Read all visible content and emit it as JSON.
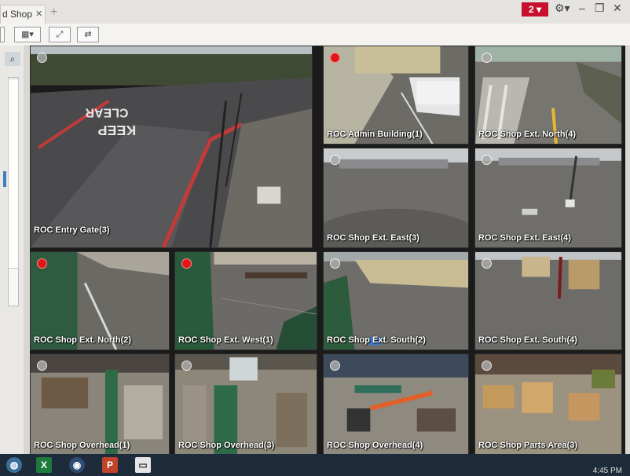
{
  "window": {
    "tab_title": "d Shop",
    "tab_close_icon": "close-icon",
    "alert_count": "2",
    "settings_icon": "gear-icon"
  },
  "toolbar": {
    "layout_button_icon": "grid-layout-icon",
    "fullscreen_icon": "expand-icon",
    "swap_icon": "swap-icon"
  },
  "cameras": [
    {
      "label": "ROC Entry Gate(3)",
      "recording": false
    },
    {
      "label": "ROC Admin Building(1)",
      "recording": true
    },
    {
      "label": "ROC Shop Ext. North(4)",
      "recording": false
    },
    {
      "label": "ROC Shop Ext. East(3)",
      "recording": false
    },
    {
      "label": "ROC Shop Ext. East(4)",
      "recording": false
    },
    {
      "label": "ROC Shop Ext. North(2)",
      "recording": true
    },
    {
      "label": "ROC Shop Ext. West(1)",
      "recording": true
    },
    {
      "label": "ROC Shop Ext. South(2)",
      "recording": false
    },
    {
      "label": "ROC Shop Ext. South(4)",
      "recording": false
    },
    {
      "label": "ROC Shop Overhead(1)",
      "recording": false
    },
    {
      "label": "ROC Shop Overhead(3)",
      "recording": false
    },
    {
      "label": "ROC Shop Overhead(4)",
      "recording": false
    },
    {
      "label": "ROC Shop Parts Area(3)",
      "recording": false
    }
  ],
  "taskbar": {
    "clock": "4:45 PM",
    "apps": [
      "app-launcher-icon",
      "excel-icon",
      "security-eye-icon",
      "powerpoint-icon",
      "photos-icon"
    ]
  },
  "colors": {
    "alert": "#c8102e",
    "recording": "#e01818",
    "taskbar": "#1d2b3a"
  }
}
